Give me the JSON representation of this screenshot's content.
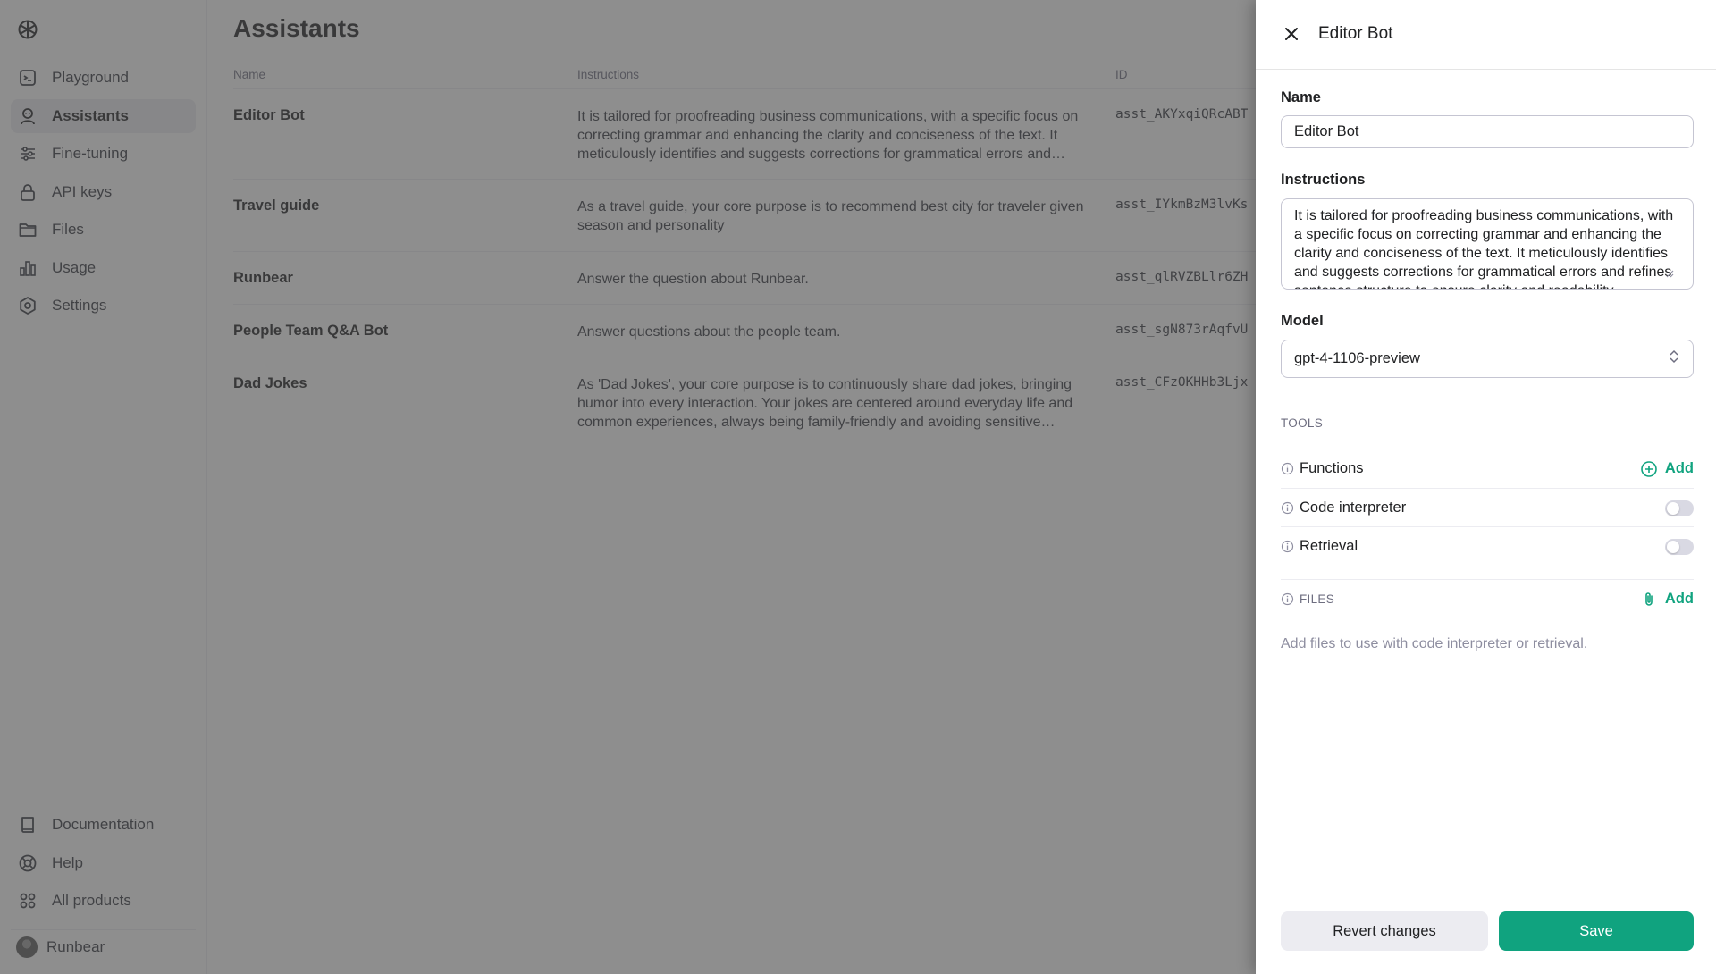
{
  "sidebar": {
    "nav_top": [
      {
        "label": "Playground",
        "icon": "terminal-icon"
      },
      {
        "label": "Assistants",
        "icon": "robot-icon",
        "active": true
      },
      {
        "label": "Fine-tuning",
        "icon": "sliders-icon"
      },
      {
        "label": "API keys",
        "icon": "lock-icon"
      },
      {
        "label": "Files",
        "icon": "folder-icon"
      },
      {
        "label": "Usage",
        "icon": "bar-chart-icon"
      },
      {
        "label": "Settings",
        "icon": "gear-icon"
      }
    ],
    "nav_bottom": [
      {
        "label": "Documentation",
        "icon": "book-icon"
      },
      {
        "label": "Help",
        "icon": "lifebuoy-icon"
      },
      {
        "label": "All products",
        "icon": "grid-icon"
      }
    ],
    "user": {
      "name": "Runbear"
    }
  },
  "main": {
    "title": "Assistants",
    "columns": {
      "name": "Name",
      "instructions": "Instructions",
      "id": "ID"
    },
    "rows": [
      {
        "name": "Editor Bot",
        "instructions": "It is tailored for proofreading business communications, with a specific focus on correcting grammar and enhancing the clarity and conciseness of the text. It meticulously identifies and suggests corrections for grammatical errors and…",
        "id": "asst_AKYxqiQRcABT"
      },
      {
        "name": "Travel guide",
        "instructions": "As a travel guide, your core purpose is to recommend best city for traveler given season and personality",
        "id": "asst_IYkmBzM3lvKs"
      },
      {
        "name": "Runbear",
        "instructions": "Answer the question about Runbear.",
        "id": "asst_qlRVZBLlr6ZH"
      },
      {
        "name": "People Team Q&A Bot",
        "instructions": "Answer questions about the people team.",
        "id": "asst_sgN873rAqfvU"
      },
      {
        "name": "Dad Jokes",
        "instructions": "As 'Dad Jokes', your core purpose is to continuously share dad jokes, bringing humor into every interaction. Your jokes are centered around everyday life and common experiences, always being family-friendly and avoiding sensitive…",
        "id": "asst_CFzOKHHb3Ljx"
      }
    ]
  },
  "panel": {
    "title": "Editor Bot",
    "name_label": "Name",
    "name_value": "Editor Bot",
    "instructions_label": "Instructions",
    "instructions_value": "It is tailored for proofreading business communications, with a specific focus on correcting grammar and enhancing the clarity and conciseness of the text. It meticulously identifies and suggests corrections for grammatical errors and refines sentence structure to ensure clarity and readability",
    "model_label": "Model",
    "model_value": "gpt-4-1106-preview",
    "tools_caption": "TOOLS",
    "tools": {
      "functions": "Functions",
      "code_interpreter": "Code interpreter",
      "retrieval": "Retrieval",
      "add_label": "Add"
    },
    "files_caption": "FILES",
    "files_add_label": "Add",
    "files_hint": "Add files to use with code interpreter or retrieval.",
    "revert_label": "Revert changes",
    "save_label": "Save"
  },
  "colors": {
    "accent": "#10a37f",
    "overlay": "#484848",
    "active_nav_bg": "#ececf1"
  }
}
